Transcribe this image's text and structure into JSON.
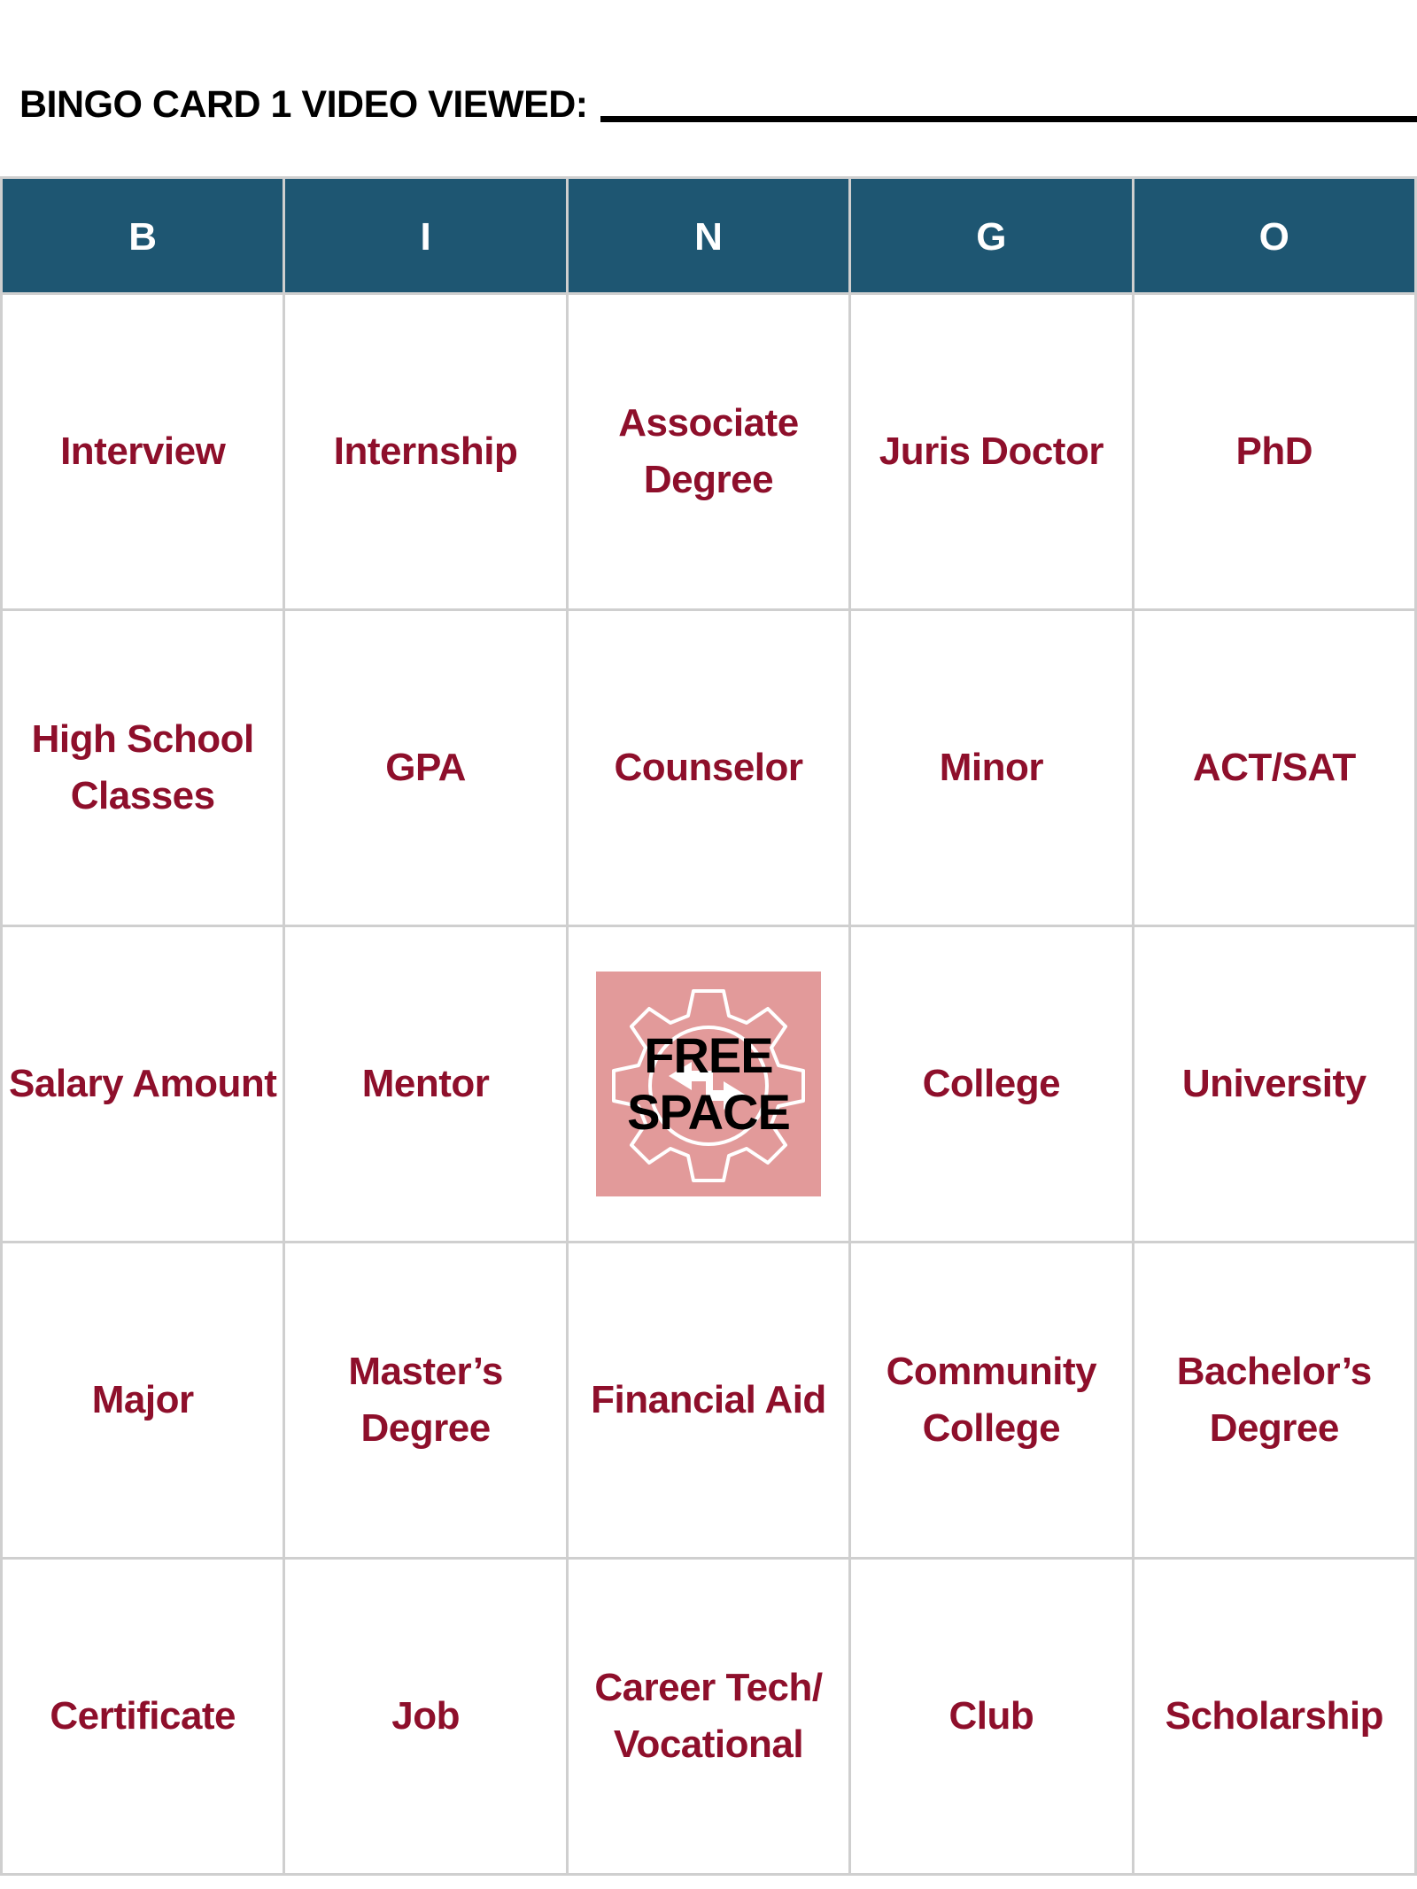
{
  "header": {
    "title": "BINGO CARD 1 VIDEO VIEWED:",
    "blank_field_value": ""
  },
  "card": {
    "columns": [
      "B",
      "I",
      "N",
      "G",
      "O"
    ],
    "rows": [
      [
        "Interview",
        "Internship",
        "Associate Degree",
        "Juris Doctor",
        "PhD"
      ],
      [
        "High School Classes",
        "GPA",
        "Counselor",
        "Minor",
        "ACT/SAT"
      ],
      [
        "Salary Amount",
        "Mentor",
        "FREE SPACE",
        "College",
        "University"
      ],
      [
        "Major",
        "Master’s Degree",
        "Financial Aid",
        "Community College",
        "Bachelor’s Degree"
      ],
      [
        "Certificate",
        "Job",
        "Career Tech/ Vocational",
        "Club",
        "Scholarship"
      ]
    ],
    "free_space": {
      "line1": "FREE",
      "line2": "SPACE",
      "icon": "gear-with-arrows-icon"
    }
  },
  "colors": {
    "header_bg": "#1E5672",
    "header_text": "#FFFFFF",
    "cell_text": "#8E0F2B",
    "grid_line": "#CFCFCF",
    "free_space_bg": "#E29A9A"
  }
}
